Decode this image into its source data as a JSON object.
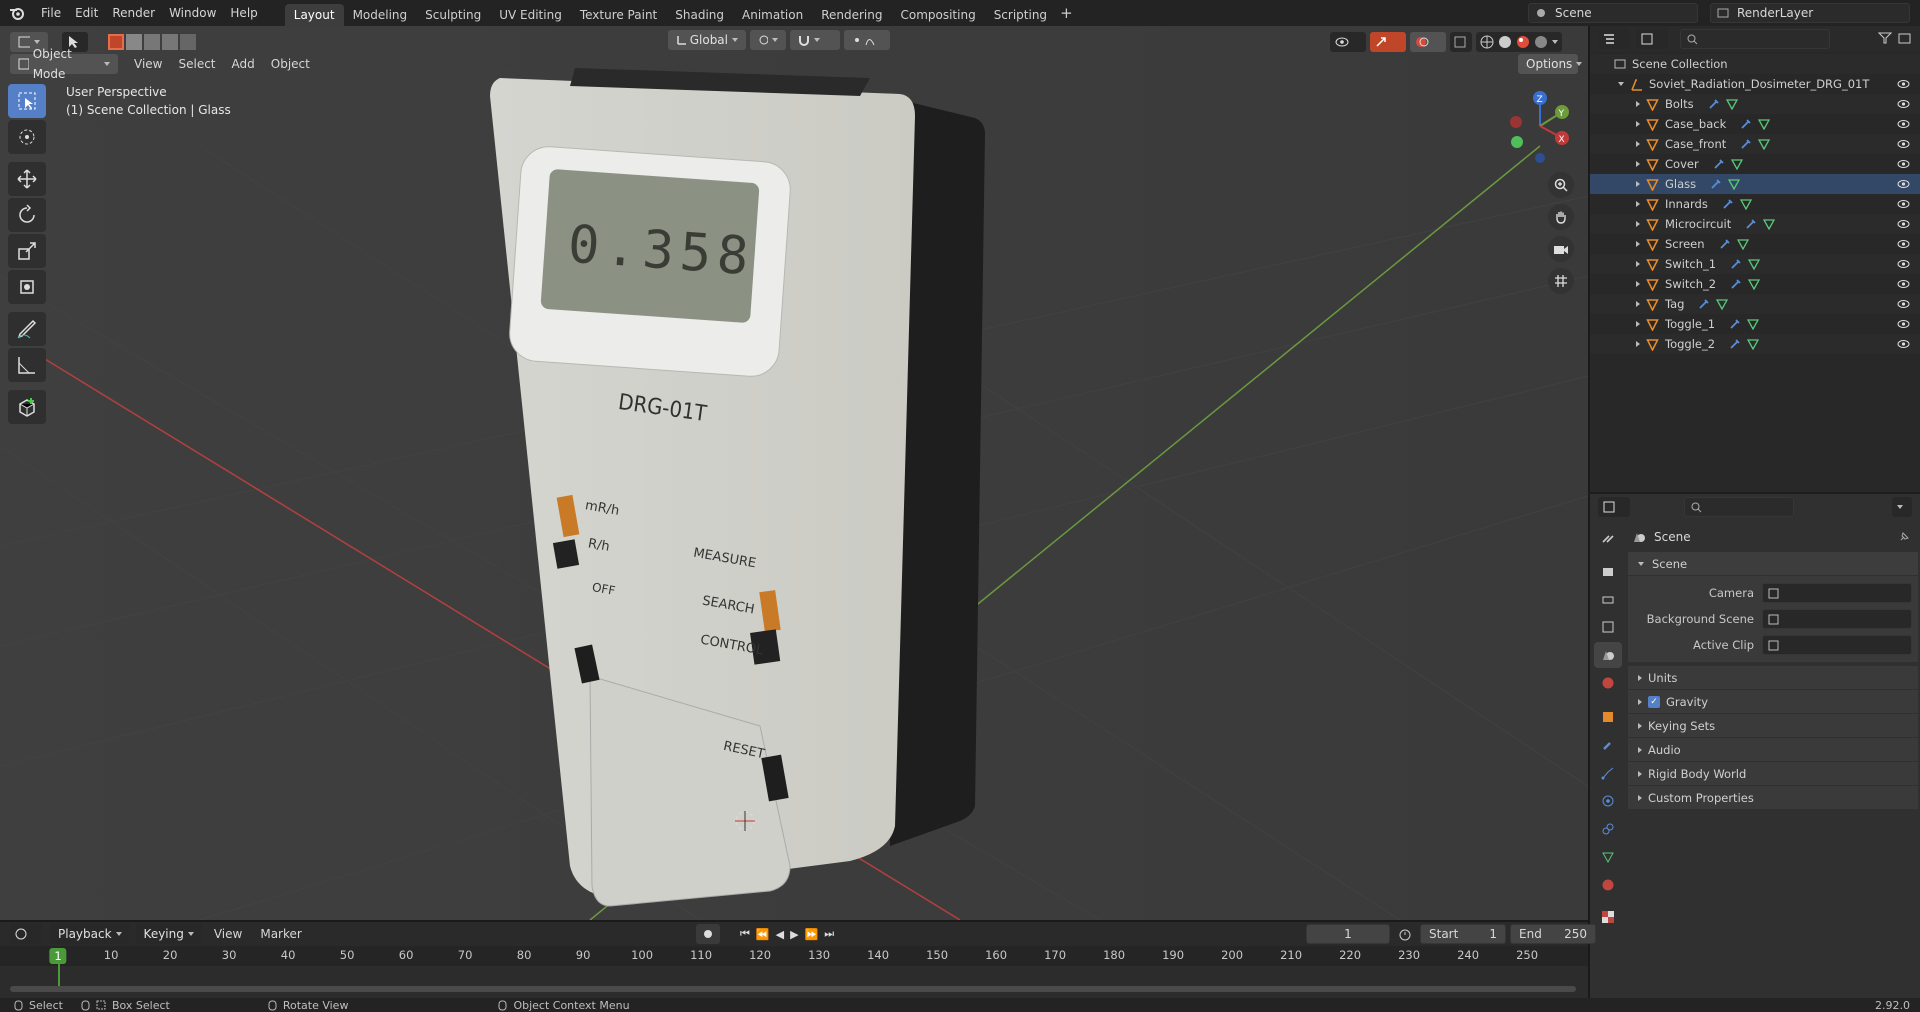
{
  "menu": [
    "File",
    "Edit",
    "Render",
    "Window",
    "Help"
  ],
  "workspaces": [
    "Layout",
    "Modeling",
    "Sculpting",
    "UV Editing",
    "Texture Paint",
    "Shading",
    "Animation",
    "Rendering",
    "Compositing",
    "Scripting"
  ],
  "active_workspace": "Layout",
  "scene_field": "Scene",
  "view_layer_field": "RenderLayer",
  "viewport": {
    "mode": "Object Mode",
    "menus": [
      "View",
      "Select",
      "Add",
      "Object"
    ],
    "orientation": "Global",
    "options_label": "Options",
    "perspective_label": "User Perspective",
    "collection_label": "(1) Scene Collection | Glass",
    "device_display": "0.358",
    "device_model": "DRG-01T",
    "device_labels": [
      "mR/h",
      "R/h",
      "OFF",
      "MEASURE",
      "SEARCH",
      "CONTROL",
      "RESET"
    ],
    "gizmo_axes": [
      "X",
      "Y",
      "Z"
    ]
  },
  "outliner": {
    "root": "Scene Collection",
    "collection": "Soviet_Radiation_Dosimeter_DRG_01T",
    "objects": [
      "Bolts",
      "Case_back",
      "Case_front",
      "Cover",
      "Glass",
      "Innards",
      "Microcircuit",
      "Screen",
      "Switch_1",
      "Switch_2",
      "Tag",
      "Toggle_1",
      "Toggle_2"
    ]
  },
  "properties": {
    "context_title": "Scene",
    "panel_title": "Scene",
    "fields": [
      {
        "label": "Camera",
        "value": ""
      },
      {
        "label": "Background Scene",
        "value": ""
      },
      {
        "label": "Active Clip",
        "value": ""
      }
    ],
    "sections": [
      {
        "label": "Units",
        "checkbox": false
      },
      {
        "label": "Gravity",
        "checkbox": true
      },
      {
        "label": "Keying Sets",
        "checkbox": false
      },
      {
        "label": "Audio",
        "checkbox": false
      },
      {
        "label": "Rigid Body World",
        "checkbox": false
      },
      {
        "label": "Custom Properties",
        "checkbox": false
      }
    ]
  },
  "timeline": {
    "menus": [
      "Playback",
      "Keying",
      "View",
      "Marker"
    ],
    "current_frame": "1",
    "start_label": "Start",
    "start": "1",
    "end_label": "End",
    "end": "250",
    "ruler": [
      "1",
      "10",
      "20",
      "30",
      "40",
      "50",
      "60",
      "70",
      "80",
      "90",
      "100",
      "110",
      "120",
      "130",
      "140",
      "150",
      "160",
      "170",
      "180",
      "190",
      "200",
      "210",
      "220",
      "230",
      "240",
      "250"
    ]
  },
  "status_bar": {
    "select": "Select",
    "box_select": "Box Select",
    "rotate_view": "Rotate View",
    "context_menu": "Object Context Menu",
    "version": "2.92.0"
  },
  "colors": {
    "accent": "#5580c8",
    "active_frame": "#4b9a3a",
    "object_icon": "#e38b2c",
    "axis_x": "#c03a3a",
    "axis_y": "#6d9a3a"
  }
}
